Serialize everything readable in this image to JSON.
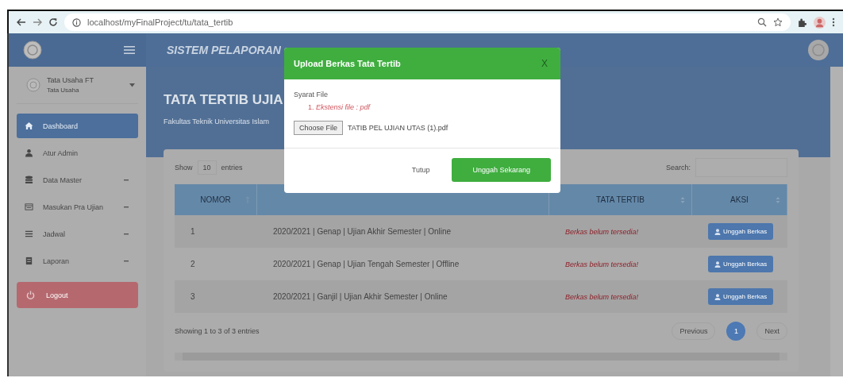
{
  "browser": {
    "url": "localhost/myFinalProject/tu/tata_tertib"
  },
  "header": {
    "title": "SISTEM PELAPORAN"
  },
  "sidebar": {
    "user_name": "Tata Usaha FT",
    "user_role": "Tata Usaha",
    "items": [
      {
        "label": "Dashboard",
        "selected": true,
        "has_submenu": false
      },
      {
        "label": "Atur Admin",
        "selected": false,
        "has_submenu": false
      },
      {
        "label": "Data Master",
        "selected": false,
        "has_submenu": true
      },
      {
        "label": "Masukan Pra Ujian",
        "selected": false,
        "has_submenu": true
      },
      {
        "label": "Jadwal",
        "selected": false,
        "has_submenu": true
      },
      {
        "label": "Laporan",
        "selected": false,
        "has_submenu": true
      }
    ],
    "logout": "Logout"
  },
  "page": {
    "title": "TATA TERTIB UJIA",
    "subtitle": "Fakultas Teknik Universitas Islam"
  },
  "table": {
    "show_label": "Show",
    "page_length": "10",
    "entries_label": "entries",
    "search_label": "Search:",
    "columns": [
      {
        "label": "NOMOR",
        "sorted": true
      },
      {
        "label": "TATA TERTIB",
        "sorted": false
      },
      {
        "label": "AKSI",
        "sorted": false
      }
    ],
    "rows": [
      {
        "number": "1",
        "exam": "2020/2021 | Genap | Ujian Akhir Semester | Online",
        "status": "Berkas belum tersedia!",
        "action": "Unggah Berkas"
      },
      {
        "number": "2",
        "exam": "2020/2021 | Genap | Ujian Tengah Semester | Offline",
        "status": "Berkas belum tersedia!",
        "action": "Unggah Berkas"
      },
      {
        "number": "3",
        "exam": "2020/2021 | Ganjil | Ujian Akhir Semester | Online",
        "status": "Berkas belum tersedia!",
        "action": "Unggah Berkas"
      }
    ],
    "info": "Showing 1 to 3 of 3 entries",
    "previous": "Previous",
    "pages": [
      {
        "label": "1",
        "selected": true
      }
    ],
    "next": "Next"
  },
  "modal": {
    "title": "Upload Berkas Tata Tertib",
    "close": "X",
    "requirements_label": "Syarat File",
    "requirements": [
      "1. *Ekstensi file : pdf*"
    ],
    "choose_file": "Choose File",
    "file_name": "TATIB PEL UJIAN UTAS (1).pdf",
    "cancel": "Tutup",
    "submit": "Unggah Sekarang"
  }
}
